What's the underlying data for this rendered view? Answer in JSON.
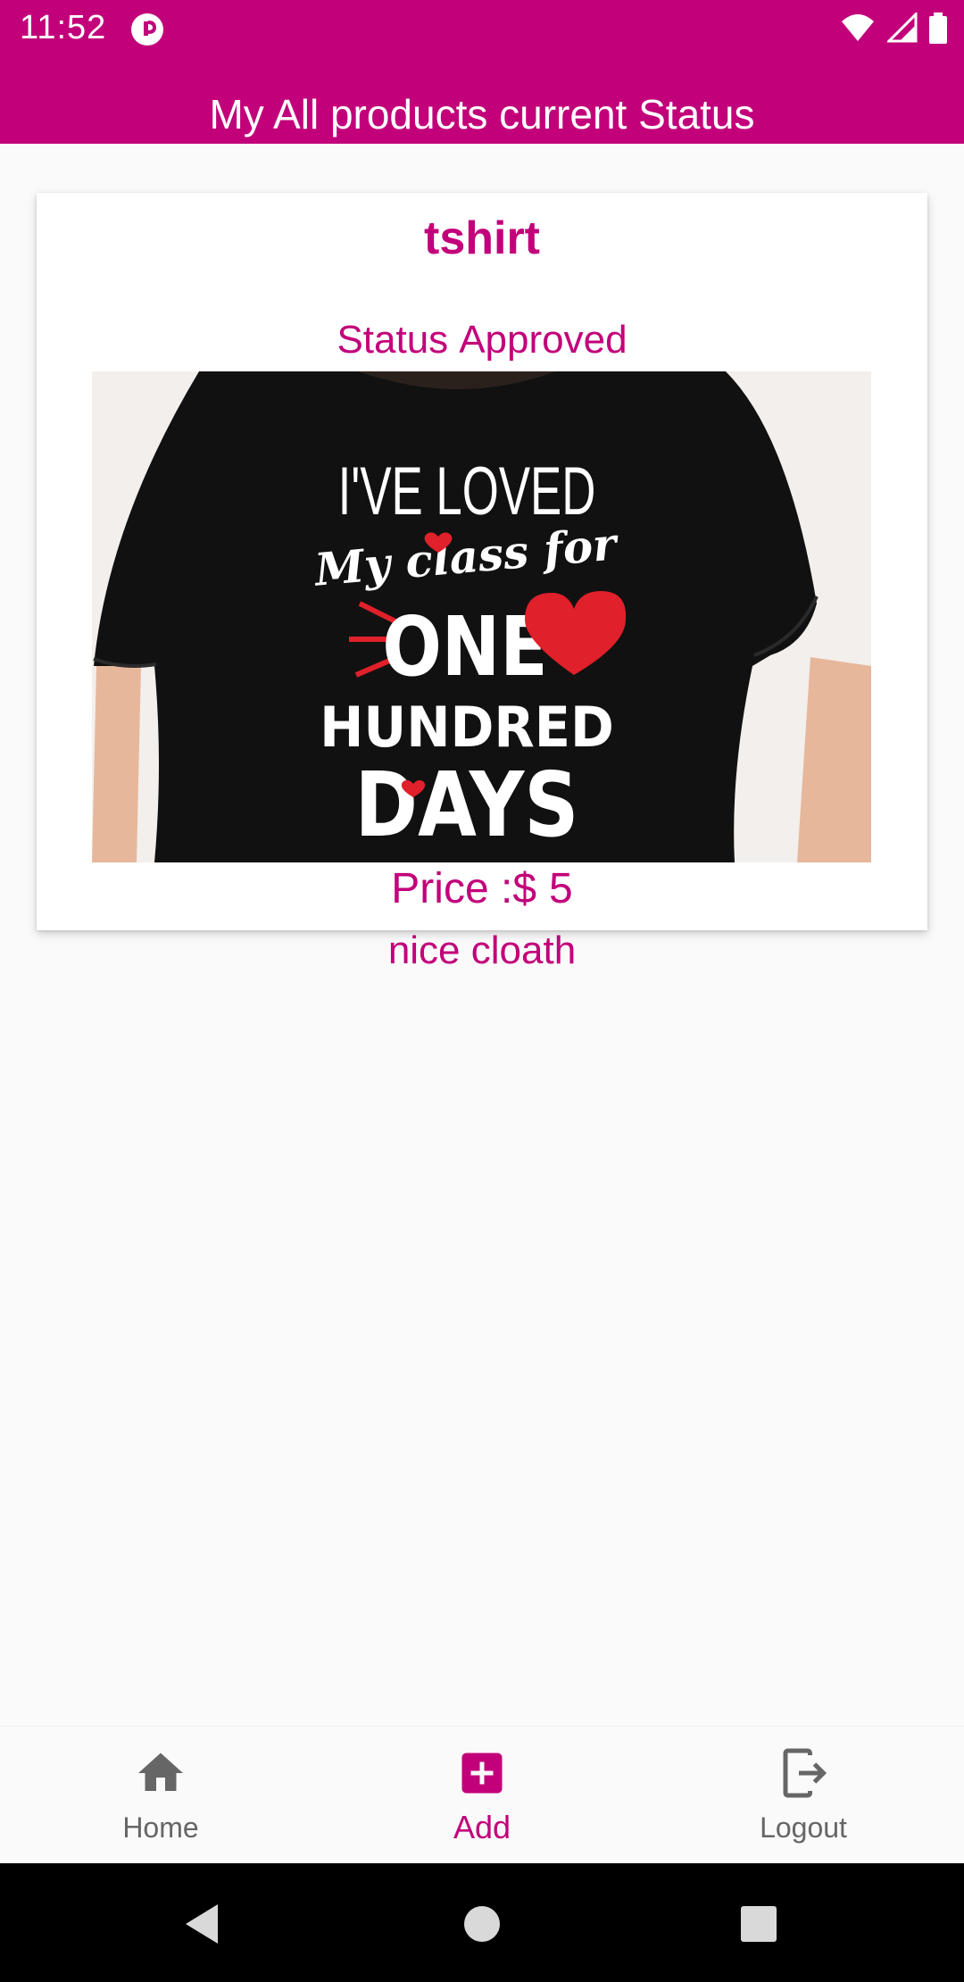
{
  "status_bar": {
    "time": "11:52"
  },
  "header": {
    "title": "My All products current Status"
  },
  "product": {
    "name": "tshirt",
    "status_label": "Status",
    "status_value": "Approved",
    "price_label": "Price :$",
    "price_value": "5",
    "description": "nice cloath",
    "image_text": [
      "I'VE LOVED",
      "My class for",
      "ONE",
      "HUNDRED",
      "DAYS"
    ]
  },
  "nav": {
    "home_label": "Home",
    "add_label": "Add",
    "logout_label": "Logout",
    "active": "Add"
  },
  "colors": {
    "primary": "#c2007a",
    "background": "#fafafa",
    "nav_inactive": "#666666"
  },
  "icons": [
    "wifi-icon",
    "signal-icon",
    "battery-icon",
    "home-icon",
    "add-box-icon",
    "logout-icon",
    "back-icon",
    "home-circle-icon",
    "recents-icon"
  ]
}
